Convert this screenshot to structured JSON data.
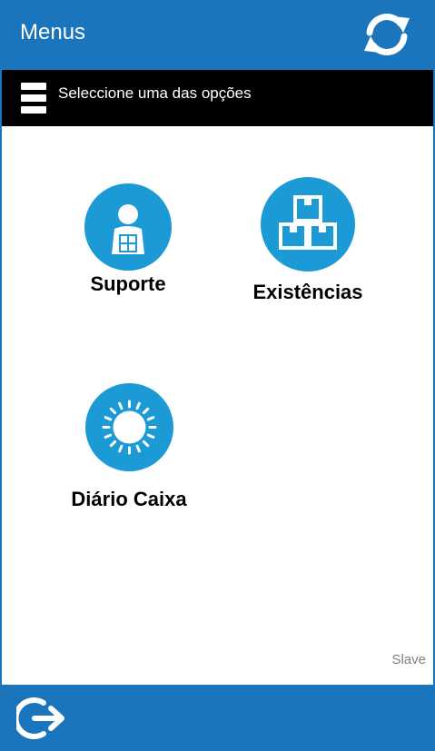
{
  "header": {
    "title": "Menus",
    "refresh_icon": "refresh-icon"
  },
  "subheader": {
    "menu_icon": "hamburger-icon",
    "text": "Seleccione uma das opções"
  },
  "menu_items": [
    {
      "label": "Suporte",
      "icon": "support-person-icon"
    },
    {
      "label": "Existências",
      "icon": "stacked-boxes-icon"
    },
    {
      "label": "Diário Caixa",
      "icon": "sun-icon"
    }
  ],
  "footer": {
    "mode_label": "Slave",
    "logout_icon": "logout-icon"
  },
  "colors": {
    "primary": "#1b75bc",
    "icon_circle": "#1b9ad6",
    "subheader": "#000000"
  }
}
